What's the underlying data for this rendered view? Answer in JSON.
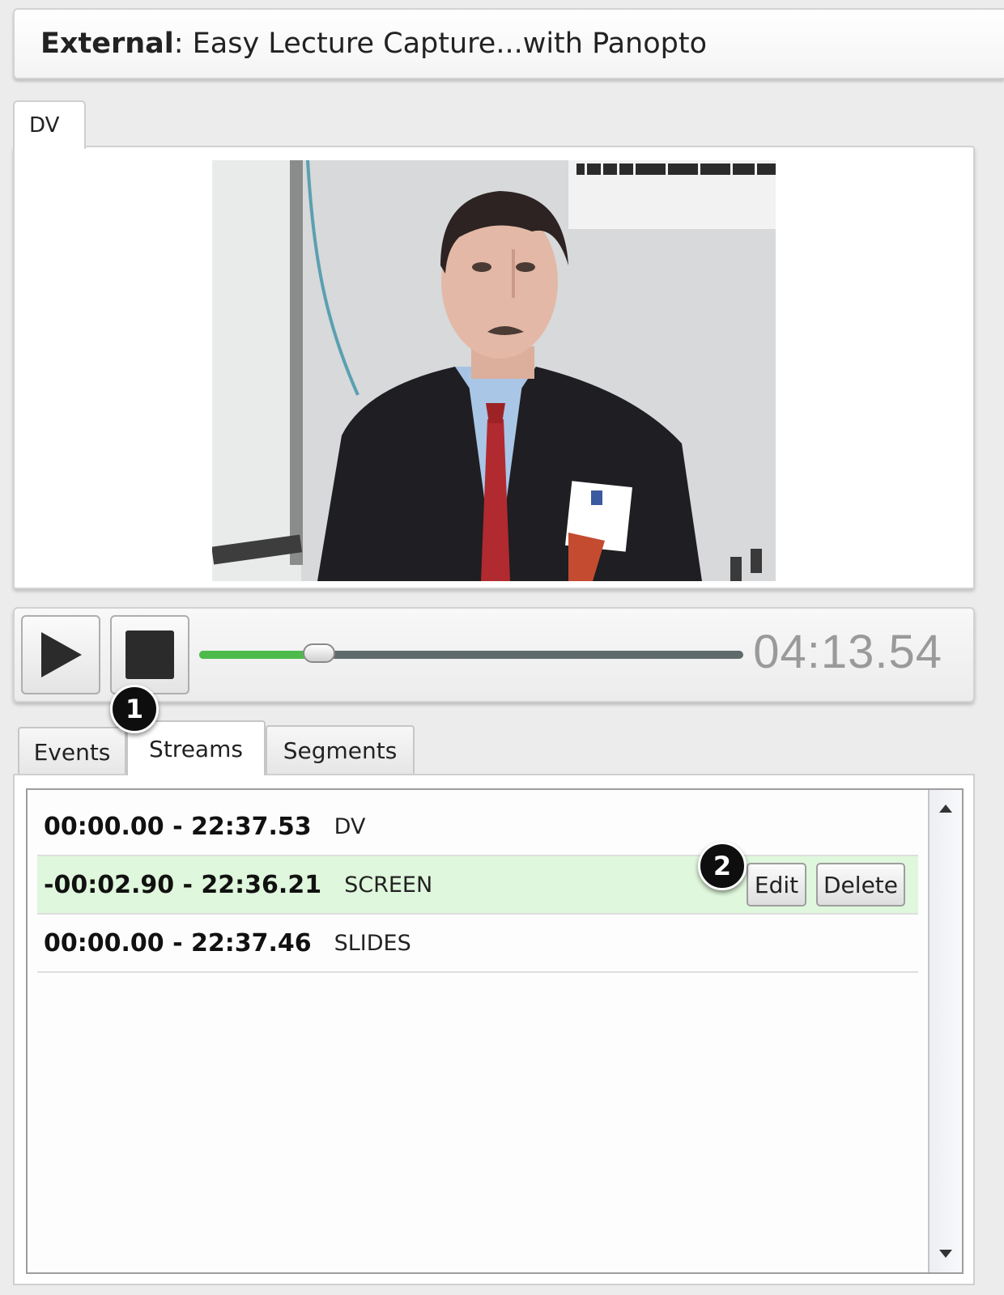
{
  "header": {
    "label": "External",
    "separator": ":",
    "title": " Easy Lecture Capture...with Panopto"
  },
  "video": {
    "tab_label": "DV"
  },
  "controls": {
    "timecode": "04:13.54",
    "progress": 0.22
  },
  "tabs": [
    {
      "label": "Events"
    },
    {
      "label": "Streams"
    },
    {
      "label": "Segments"
    }
  ],
  "streams": [
    {
      "range": "00:00.00 - 22:37.53",
      "name": "DV"
    },
    {
      "range": "-00:02.90 - 22:36.21",
      "name": "SCREEN"
    },
    {
      "range": "00:00.00 - 22:37.46",
      "name": "SLIDES"
    }
  ],
  "row_actions": {
    "edit_label": "Edit",
    "delete_label": "Delete"
  },
  "callouts": {
    "one": "1",
    "two": "2"
  },
  "colors": {
    "progress_fill": "#4cbb4c",
    "selected_row": "#dff7dc",
    "badge": "#0e0e0e"
  }
}
